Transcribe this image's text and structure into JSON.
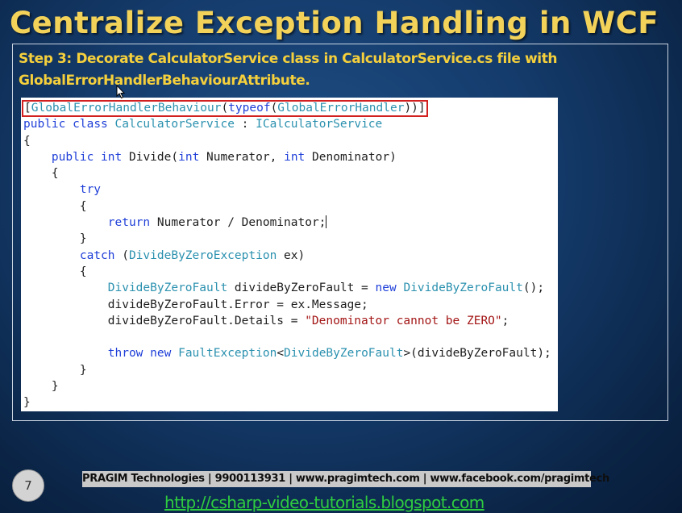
{
  "slide": {
    "title": "Centralize Exception Handling in WCF",
    "step_line1": "Step 3: Decorate CalculatorService class in CalculatorService.cs file with",
    "step_line2": "GlobalErrorHandlerBehaviourAttribute.",
    "slide_number": "7"
  },
  "code": {
    "attribute_type": "GlobalErrorHandlerBehaviour",
    "typeof_kw": "typeof",
    "handler_type": "GlobalErrorHandler",
    "kw_public": "public",
    "kw_class": "class",
    "class_name": "CalculatorService",
    "interface_name": "ICalculatorService",
    "kw_int": "int",
    "method_name": "Divide",
    "param1": "Numerator",
    "param2": "Denominator",
    "kw_try": "try",
    "kw_return": "return",
    "return_expr": "Numerator / Denominator;",
    "kw_catch": "catch",
    "exception_type": "DivideByZeroException",
    "exception_var": "ex",
    "fault_type": "DivideByZeroFault",
    "fault_var": "divideByZeroFault",
    "kw_new": "new",
    "assign_error": "divideByZeroFault.Error = ex.Message;",
    "assign_details_lhs": "divideByZeroFault.Details = ",
    "details_string": "\"Denominator cannot be ZERO\"",
    "kw_throw": "throw",
    "fault_exception": "FaultException"
  },
  "footer": {
    "bar_text": "PRAGIM Technologies | 9900113931 | www.pragimtech.com | www.facebook.com/pragimtech",
    "blog_link": "http://csharp-video-tutorials.blogspot.com"
  },
  "colors": {
    "title": "#f3d25a",
    "step_text": "#f5d03c",
    "keyword": "#1f3fd8",
    "type": "#2b91af",
    "string": "#a31515",
    "highlight_box": "#d21f1f",
    "link": "#2ecc40"
  }
}
